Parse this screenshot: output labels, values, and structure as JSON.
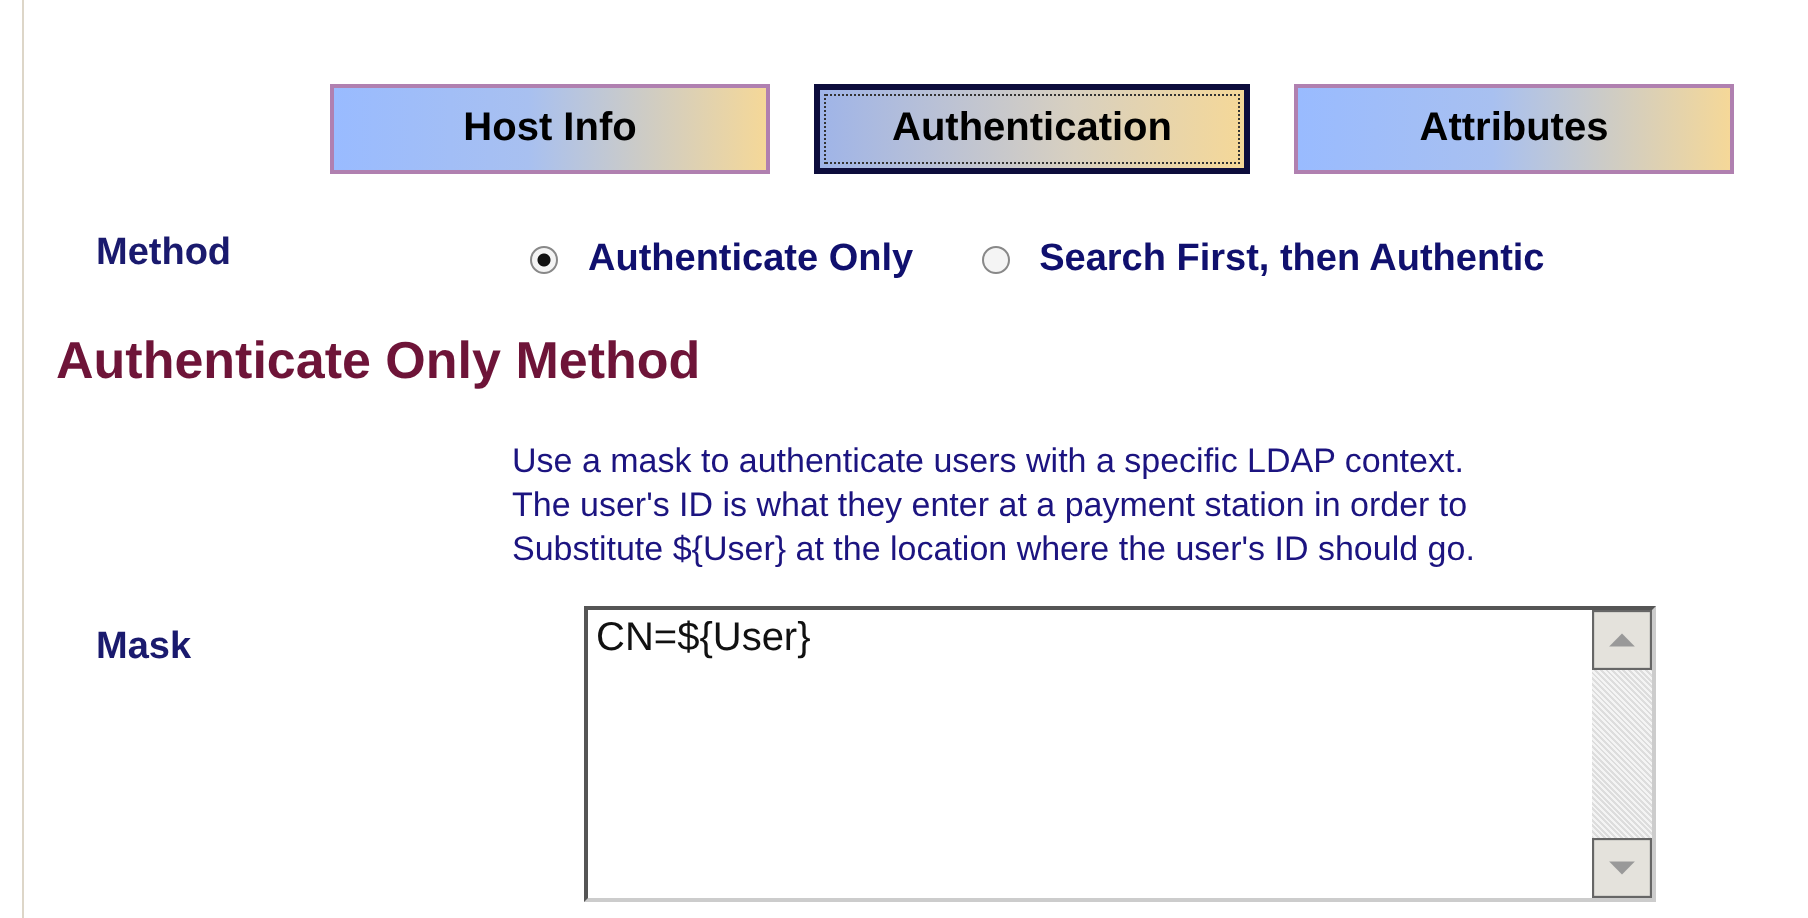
{
  "tabs": [
    {
      "label": "Host Info",
      "selected": false
    },
    {
      "label": "Authentication",
      "selected": true
    },
    {
      "label": "Attributes",
      "selected": false
    }
  ],
  "method": {
    "label": "Method",
    "options": [
      {
        "label": "Authenticate Only",
        "selected": true
      },
      {
        "label": "Search First, then Authentic",
        "selected": false
      }
    ]
  },
  "section": {
    "title": "Authenticate Only Method",
    "description": [
      "Use a mask to authenticate users with a specific LDAP context.",
      "The user's ID is what they enter at a payment station in order to",
      "Substitute ${User} at the location where the user's ID should go."
    ],
    "mask": {
      "label": "Mask",
      "value": "CN=${User}"
    }
  }
}
